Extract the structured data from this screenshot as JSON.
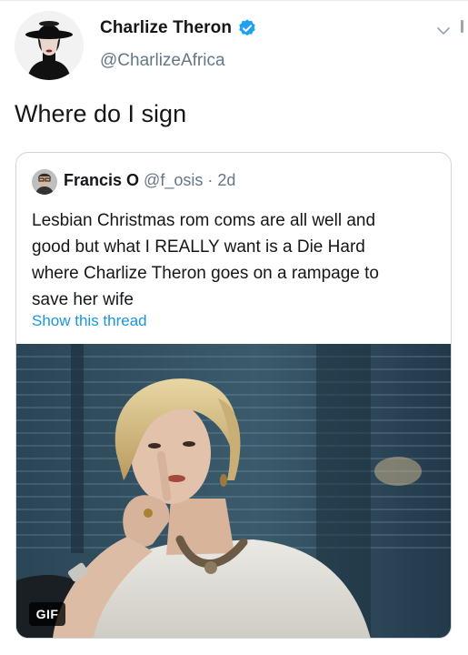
{
  "tweet": {
    "author": {
      "display_name": "Charlize Theron",
      "handle": "@CharlizeAfrica",
      "verified_icon": "verified-badge-icon"
    },
    "text": "Where do I sign",
    "menu_icon": "chevron-down-icon"
  },
  "quoted_tweet": {
    "author": {
      "display_name": "Francis O",
      "handle": "@f_osis",
      "separator": "·",
      "age": "2d"
    },
    "text_lines": [
      "Lesbian Christmas rom coms are all well and",
      "good but what I REALLY want is a Die Hard",
      "where Charlize Theron goes on a rampage to",
      "save her wife"
    ],
    "show_thread_label": "Show this thread",
    "media": {
      "type": "gif",
      "badge_label": "GIF"
    }
  },
  "colors": {
    "accent": "#1b95e0",
    "verified": "#1da1f2",
    "text_primary": "#14171a",
    "text_secondary": "#657786",
    "border": "#ccd6dd"
  }
}
